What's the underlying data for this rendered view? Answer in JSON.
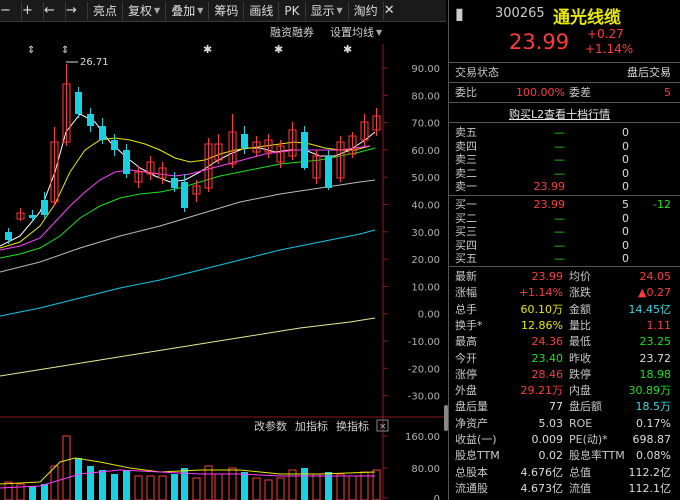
{
  "toolbar": {
    "items": [
      "亮点",
      "复权",
      "叠加",
      "筹码",
      "画线",
      "PK",
      "显示",
      "淘约"
    ]
  },
  "subbar": {
    "margin": "融资融券",
    "ma_setting": "设置均线"
  },
  "chart": {
    "peak_label": "26.71",
    "price_axis": [
      "90.00",
      "80.00",
      "70.00",
      "60.00",
      "50.00",
      "40.00",
      "30.00",
      "20.00",
      "10.00",
      "0.00",
      "-10.00",
      "-20.00",
      "-30.00"
    ],
    "vol_axis": [
      "160.00",
      "80.00",
      "0"
    ],
    "vol_tools": {
      "params": "改参数",
      "add": "加指标",
      "switch": "换指标",
      "close": "×"
    }
  },
  "quote": {
    "code": "300265",
    "name": "通光线缆",
    "price": "23.99",
    "change": "+0.27",
    "change_pct": "+1.14%"
  },
  "trade_state": {
    "label": "交易状态",
    "value": "盘后交易"
  },
  "ratio": {
    "label1": "委比",
    "value1": "100.00%",
    "label2": "委差",
    "value2": "5"
  },
  "l2_link": "购买L2查看十档行情",
  "asks": [
    {
      "label": "卖五",
      "price": "—",
      "vol": "0",
      "change": ""
    },
    {
      "label": "卖四",
      "price": "—",
      "vol": "0",
      "change": ""
    },
    {
      "label": "卖三",
      "price": "—",
      "vol": "0",
      "change": ""
    },
    {
      "label": "卖二",
      "price": "—",
      "vol": "0",
      "change": ""
    },
    {
      "label": "卖一",
      "price": "23.99",
      "vol": "0",
      "change": ""
    }
  ],
  "bids": [
    {
      "label": "买一",
      "price": "23.99",
      "vol": "5",
      "change": "-12"
    },
    {
      "label": "买二",
      "price": "—",
      "vol": "0",
      "change": ""
    },
    {
      "label": "买三",
      "price": "—",
      "vol": "0",
      "change": ""
    },
    {
      "label": "买四",
      "price": "—",
      "vol": "0",
      "change": ""
    },
    {
      "label": "买五",
      "price": "—",
      "vol": "0",
      "change": ""
    }
  ],
  "stats": [
    {
      "l1": "最新",
      "v1": "23.99",
      "c1": "red",
      "l2": "均价",
      "v2": "24.05",
      "c2": "red"
    },
    {
      "l1": "涨幅",
      "v1": "+1.14%",
      "c1": "red",
      "l2": "涨跌",
      "v2": "▲0.27",
      "c2": "red"
    },
    {
      "l1": "总手",
      "v1": "60.10万",
      "c1": "yellow",
      "l2": "金额",
      "v2": "14.45亿",
      "c2": "cyan"
    },
    {
      "l1": "换手*",
      "v1": "12.86%",
      "c1": "yellow",
      "l2": "量比",
      "v2": "1.11",
      "c2": "red"
    },
    {
      "l1": "最高",
      "v1": "24.36",
      "c1": "red",
      "l2": "最低",
      "v2": "23.25",
      "c2": "green"
    },
    {
      "l1": "今开",
      "v1": "23.40",
      "c1": "green",
      "l2": "昨收",
      "v2": "23.72",
      "c2": "white"
    },
    {
      "l1": "涨停",
      "v1": "28.46",
      "c1": "red",
      "l2": "跌停",
      "v2": "18.98",
      "c2": "green"
    },
    {
      "l1": "外盘",
      "v1": "29.21万",
      "c1": "red",
      "l2": "内盘",
      "v2": "30.89万",
      "c2": "green"
    },
    {
      "l1": "盘后量",
      "v1": "77",
      "c1": "white",
      "l2": "盘后额",
      "v2": "18.5万",
      "c2": "cyan"
    },
    {
      "l1": "净资产",
      "v1": "5.03",
      "c1": "white",
      "l2": "ROE",
      "v2": "0.17%",
      "c2": "white"
    },
    {
      "l1": "收益(一)",
      "v1": "0.009",
      "c1": "white",
      "l2": "PE(动)*",
      "v2": "698.87",
      "c2": "white"
    },
    {
      "l1": "股息TTM",
      "v1": "0.02",
      "c1": "white",
      "l2": "股息率TTM",
      "v2": "0.08%",
      "c2": "white"
    },
    {
      "l1": "总股本",
      "v1": "4.676亿",
      "c1": "white",
      "l2": "总值",
      "v2": "112.2亿",
      "c2": "white"
    },
    {
      "l1": "流通股",
      "v1": "4.673亿",
      "c1": "white",
      "l2": "流值",
      "v2": "112.1亿",
      "c2": "white"
    }
  ]
}
